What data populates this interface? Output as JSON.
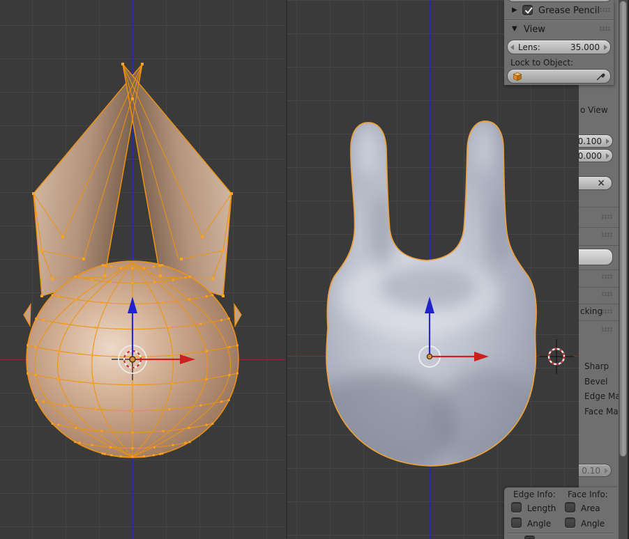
{
  "icons": {
    "expand_collapsed": "▶",
    "expand_open": "▼",
    "checkmark": "✓",
    "clear": "×"
  },
  "colors": {
    "viewport_bg": "#3a3a3a",
    "panel_bg": "#6f6f6f",
    "wire_orange": "#ef9210",
    "vertex_orange": "#ffa21f",
    "outline_orange": "#eda13c",
    "axis_red": "#8b2c2c",
    "axis_blue": "#2b2ba8",
    "text_dark": "#1a1a1a"
  },
  "view_panel": {
    "grease_pencil_label": "Grease Pencil",
    "view_label": "View",
    "lens_label": "Lens:",
    "lens_value": "35.000",
    "lock_to_object_label": "Lock to Object:"
  },
  "side_strip": {
    "lock_camera_to_view_tail": "o View",
    "value_top": "0.100",
    "value_bottom": "0.000",
    "tracking_header_tail": "cking",
    "mesh_display_labels": [
      "Sharp",
      "Bevel",
      "Edge Ma",
      "Face Ma"
    ],
    "normal_size_value": "0.10"
  },
  "mesh_info_panel": {
    "edge_info_label": "Edge Info:",
    "face_info_label": "Face Info:",
    "edge_checkboxes": [
      {
        "label": "Length"
      },
      {
        "label": "Angle"
      }
    ],
    "face_checkboxes": [
      {
        "label": "Area"
      },
      {
        "label": "Angle"
      }
    ]
  }
}
